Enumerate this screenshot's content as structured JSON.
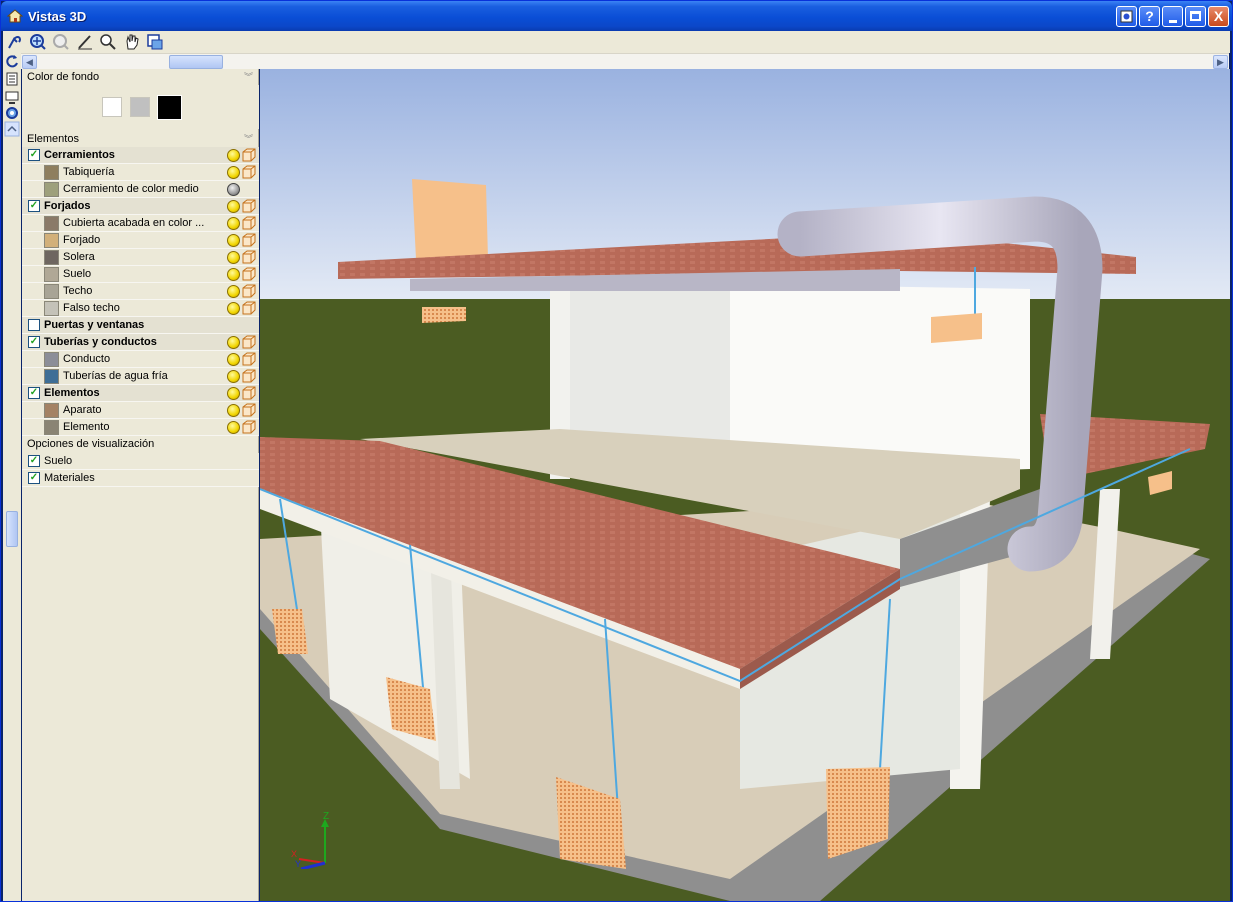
{
  "window": {
    "title": "Vistas 3D",
    "controls": [
      "help-book",
      "?",
      "_",
      "□",
      "X"
    ]
  },
  "toolbar": {
    "tools": [
      "orbit-icon",
      "zoom-window-icon",
      "zoom-extents-icon",
      "edit-icon",
      "zoom-icon",
      "pan-hand-icon",
      "views-icon"
    ]
  },
  "panel": {
    "background_section": {
      "title": "Color de fondo",
      "swatches": [
        {
          "name": "white",
          "color": "#ffffff",
          "selected": false
        },
        {
          "name": "gray",
          "color": "#c0c0c0",
          "selected": false
        },
        {
          "name": "black",
          "color": "#000000",
          "selected": true
        }
      ]
    },
    "elements_section": {
      "title": "Elementos",
      "rows": [
        {
          "kind": "group",
          "label": "Cerramientos",
          "checked": true,
          "bulb": "on"
        },
        {
          "kind": "item",
          "label": "Tabiquería",
          "color": "#8e7e5e",
          "bulb": "on"
        },
        {
          "kind": "item",
          "label": "Cerramiento de color medio",
          "color": "#9ea07c",
          "bulb": "off"
        },
        {
          "kind": "group",
          "label": "Forjados",
          "checked": true,
          "bulb": "on"
        },
        {
          "kind": "item",
          "label": "Cubierta acabada en color ...",
          "color": "#8a7a68",
          "bulb": "on"
        },
        {
          "kind": "item",
          "label": "Forjado",
          "color": "#d2b07a",
          "bulb": "on"
        },
        {
          "kind": "item",
          "label": "Solera",
          "color": "#6e6660",
          "bulb": "on"
        },
        {
          "kind": "item",
          "label": "Suelo",
          "color": "#b0a896",
          "bulb": "on"
        },
        {
          "kind": "item",
          "label": "Techo",
          "color": "#a8a496",
          "bulb": "on"
        },
        {
          "kind": "item",
          "label": "Falso techo",
          "color": "#c4c2b8",
          "bulb": "on"
        },
        {
          "kind": "group",
          "label": "Puertas y ventanas",
          "checked": false,
          "bulb": "none"
        },
        {
          "kind": "group",
          "label": "Tuberías y conductos",
          "checked": true,
          "bulb": "on"
        },
        {
          "kind": "item",
          "label": "Conducto",
          "color": "#8c8e98",
          "bulb": "on"
        },
        {
          "kind": "item",
          "label": "Tuberías de agua fría",
          "color": "#3e6e96",
          "bulb": "on"
        },
        {
          "kind": "group",
          "label": "Elementos",
          "checked": true,
          "bulb": "on"
        },
        {
          "kind": "item",
          "label": "Aparato",
          "color": "#a48264",
          "bulb": "on"
        },
        {
          "kind": "item",
          "label": "Elemento",
          "color": "#8a8474",
          "bulb": "on"
        }
      ]
    },
    "display_options": {
      "title": "Opciones de visualización",
      "options": [
        {
          "label": "Suelo",
          "checked": true
        },
        {
          "label": "Materiales",
          "checked": true
        }
      ]
    }
  },
  "viewport": {
    "axes": {
      "x": "X",
      "y": "Y",
      "z": "Z"
    },
    "sky_color": "#9ab2e0",
    "ground_color": "#4b5c22"
  }
}
